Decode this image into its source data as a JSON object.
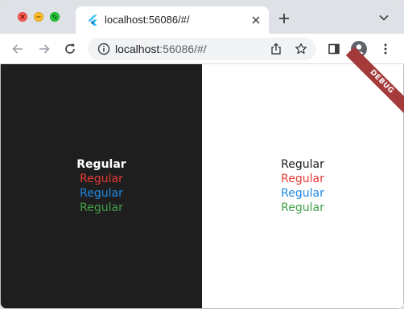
{
  "browser": {
    "tab": {
      "title": "localhost:56086/#/",
      "favicon": "flutter-icon"
    },
    "address": {
      "host": "localhost",
      "rest": ":56086/#/"
    },
    "icons": {
      "back": "back-arrow-icon",
      "forward": "forward-arrow-icon",
      "reload": "reload-icon",
      "info": "info-icon",
      "share": "share-icon",
      "bookmark": "star-icon",
      "side_panel": "side-panel-icon",
      "profile": "avatar-icon",
      "menu": "kebab-menu-icon",
      "new_tab": "plus-icon",
      "tab_close": "close-icon",
      "tab_search": "chevron-down-icon"
    }
  },
  "app": {
    "debug_banner": "DEBUG",
    "dark_panel": {
      "background": "#1e1e1e",
      "items": [
        "Regular",
        "Regular",
        "Regular",
        "Regular"
      ]
    },
    "light_panel": {
      "background": "#ffffff",
      "items": [
        "Regular",
        "Regular",
        "Regular",
        "Regular"
      ]
    },
    "colors": {
      "red": "#e53935",
      "blue": "#1e88e5",
      "green": "#43a047"
    }
  }
}
